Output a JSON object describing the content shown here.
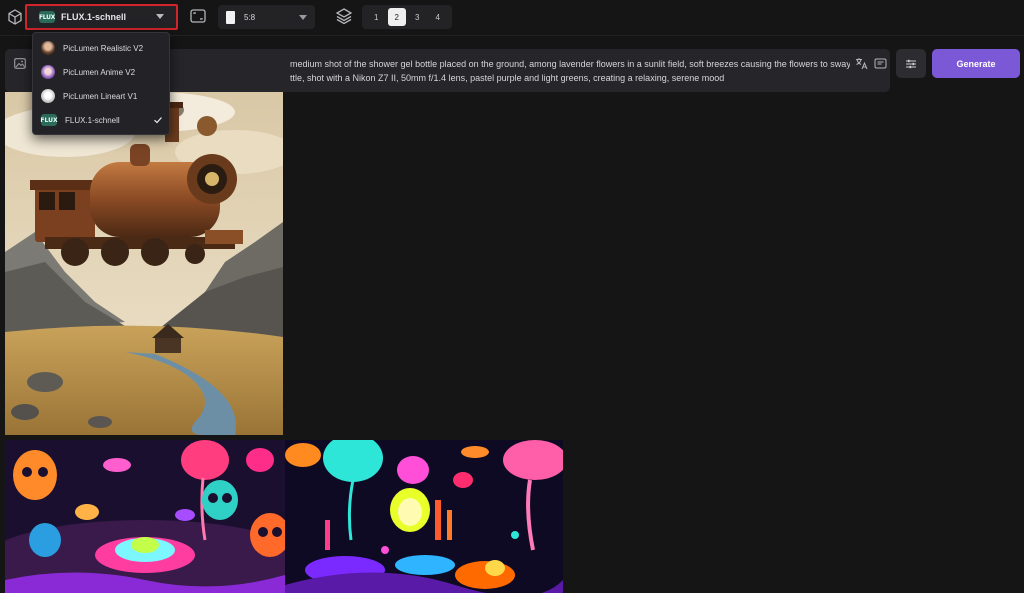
{
  "toolbar": {
    "model_select": {
      "badge": "FLUX",
      "label": "FLUX.1-schnell"
    },
    "ratio_select": {
      "label": "5:8"
    },
    "count_options": [
      "1",
      "2",
      "3",
      "4"
    ],
    "count_selected": "2",
    "icons": [
      "cube-icon",
      "aspect-icon",
      "layers-icon"
    ]
  },
  "model_menu": {
    "items": [
      {
        "label": "PicLumen Realistic V2",
        "thumb_color": "#8a5a3c",
        "selected": false
      },
      {
        "label": "PicLumen Anime V2",
        "thumb_color": "#8e5cc0",
        "selected": false
      },
      {
        "label": "PicLumen Lineart V1",
        "thumb_color": "#c9c9cc",
        "selected": false
      },
      {
        "label": "FLUX.1-schnell",
        "badge": "FLUX",
        "selected": true
      }
    ]
  },
  "prompt": {
    "line1": "medium shot of the shower gel bottle placed on the ground, among lavender flowers in a sunlit field, soft breezes causing the flowers to sway gently, the light",
    "line2": "ttle, shot with a Nikon Z7 II, 50mm f/1.4 lens, pastel purple and light greens, creating a relaxing, serene mood"
  },
  "actions": {
    "generate_label": "Generate"
  },
  "colors": {
    "background": "#151516",
    "accent": "#7b58d6",
    "highlight_border": "#d1242b"
  },
  "gallery": [
    {
      "alt": "flying steam locomotive over mountain valley"
    },
    {
      "alt": "neon psychedelic mushroom and skull landscape"
    },
    {
      "alt": "neon psychedelic mushroom forest with lit towers"
    }
  ]
}
